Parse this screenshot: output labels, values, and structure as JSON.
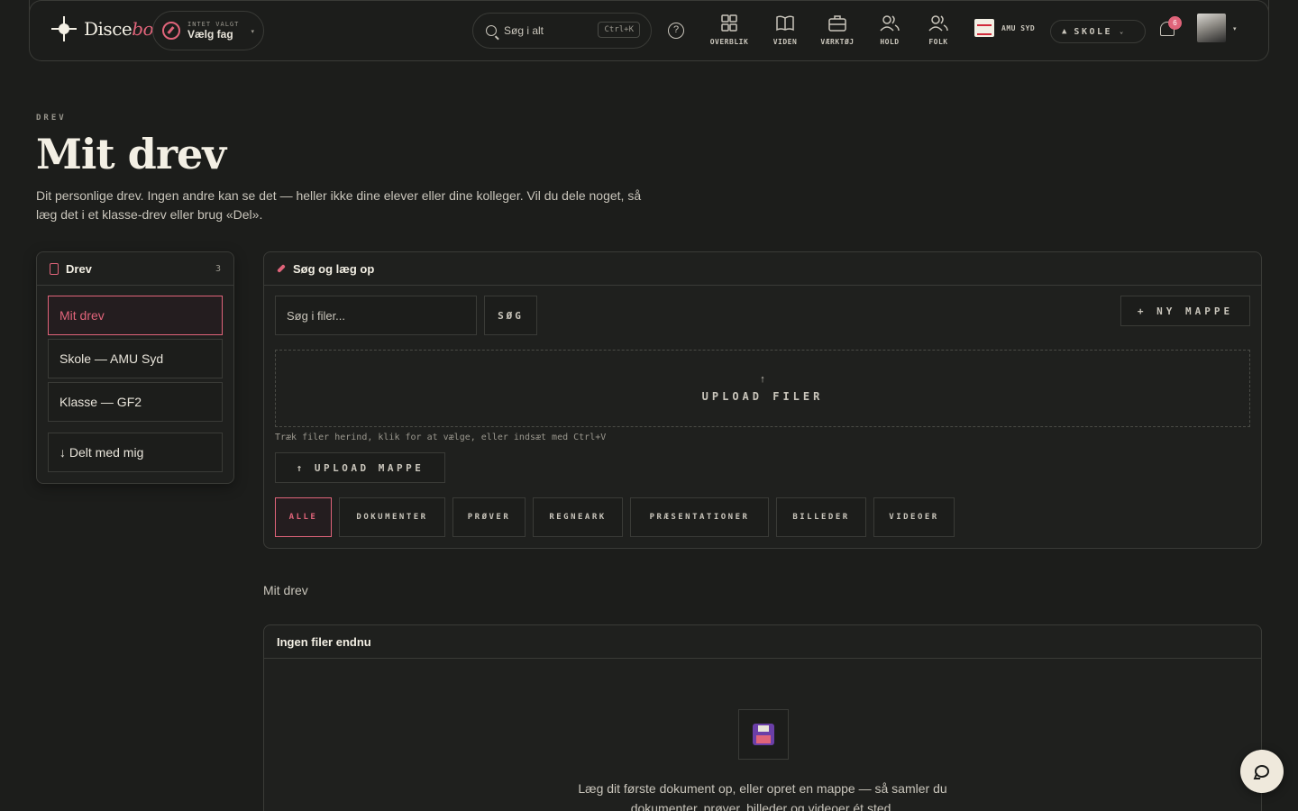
{
  "topbar": {
    "logo_text_main": "Disce",
    "logo_text_accent": "bo",
    "subject_small": "INTET VALGT",
    "subject_main": "Vælg fag",
    "search_label": "Søg i alt",
    "search_shortcut": "Ctrl+K",
    "nav": [
      {
        "label": "OVERBLIK",
        "icon": "grid-icon"
      },
      {
        "label": "VIDEN",
        "icon": "book-icon"
      },
      {
        "label": "VÆRKTØJ",
        "icon": "briefcase-icon"
      },
      {
        "label": "HOLD",
        "icon": "users-icon"
      },
      {
        "label": "FOLK",
        "icon": "people-icon"
      }
    ],
    "school_name": "AMU SYD",
    "mode_label": "SKOLE",
    "notification_count": "6"
  },
  "header": {
    "eyebrow": "DREV",
    "title": "Mit drev",
    "lead": "Dit personlige drev. Ingen andre kan se det — heller ikke dine elever eller dine kolleger. Vil du dele noget, så læg det i et klasse-drev eller brug «Del»."
  },
  "sidebar": {
    "title": "Drev",
    "count": "3",
    "items": [
      {
        "label": "Mit drev",
        "active": true
      },
      {
        "label": "Skole — AMU Syd",
        "active": false
      },
      {
        "label": "Klasse — GF2",
        "active": false
      },
      {
        "label": "↓ Delt med mig",
        "active": false
      }
    ]
  },
  "search_upload": {
    "title": "Søg og læg op",
    "search_placeholder": "Søg i filer...",
    "search_button": "SØG",
    "new_folder_button": "+ NY MAPPE",
    "drop_arrow": "↑",
    "drop_label": "UPLOAD FILER",
    "hint": "Træk filer herind, klik for at vælge, eller indsæt med Ctrl+V",
    "upload_folder_button": "↑  UPLOAD MAPPE",
    "filters": [
      "ALLE",
      "DOKUMENTER",
      "PRØVER",
      "REGNEARK",
      "PRÆSENTATIONER",
      "BILLEDER",
      "VIDEOER"
    ],
    "active_filter": "ALLE"
  },
  "breadcrumb": "Mit drev",
  "empty": {
    "title": "Ingen filer endnu",
    "text": "Læg dit første dokument op, eller opret en mappe — så samler du dokumenter, prøver, billeder og videoer ét sted."
  },
  "colors": {
    "background": "#1c1d1b",
    "accent": "#e0647a",
    "border": "#3a3b37",
    "text": "#e8e4da"
  }
}
